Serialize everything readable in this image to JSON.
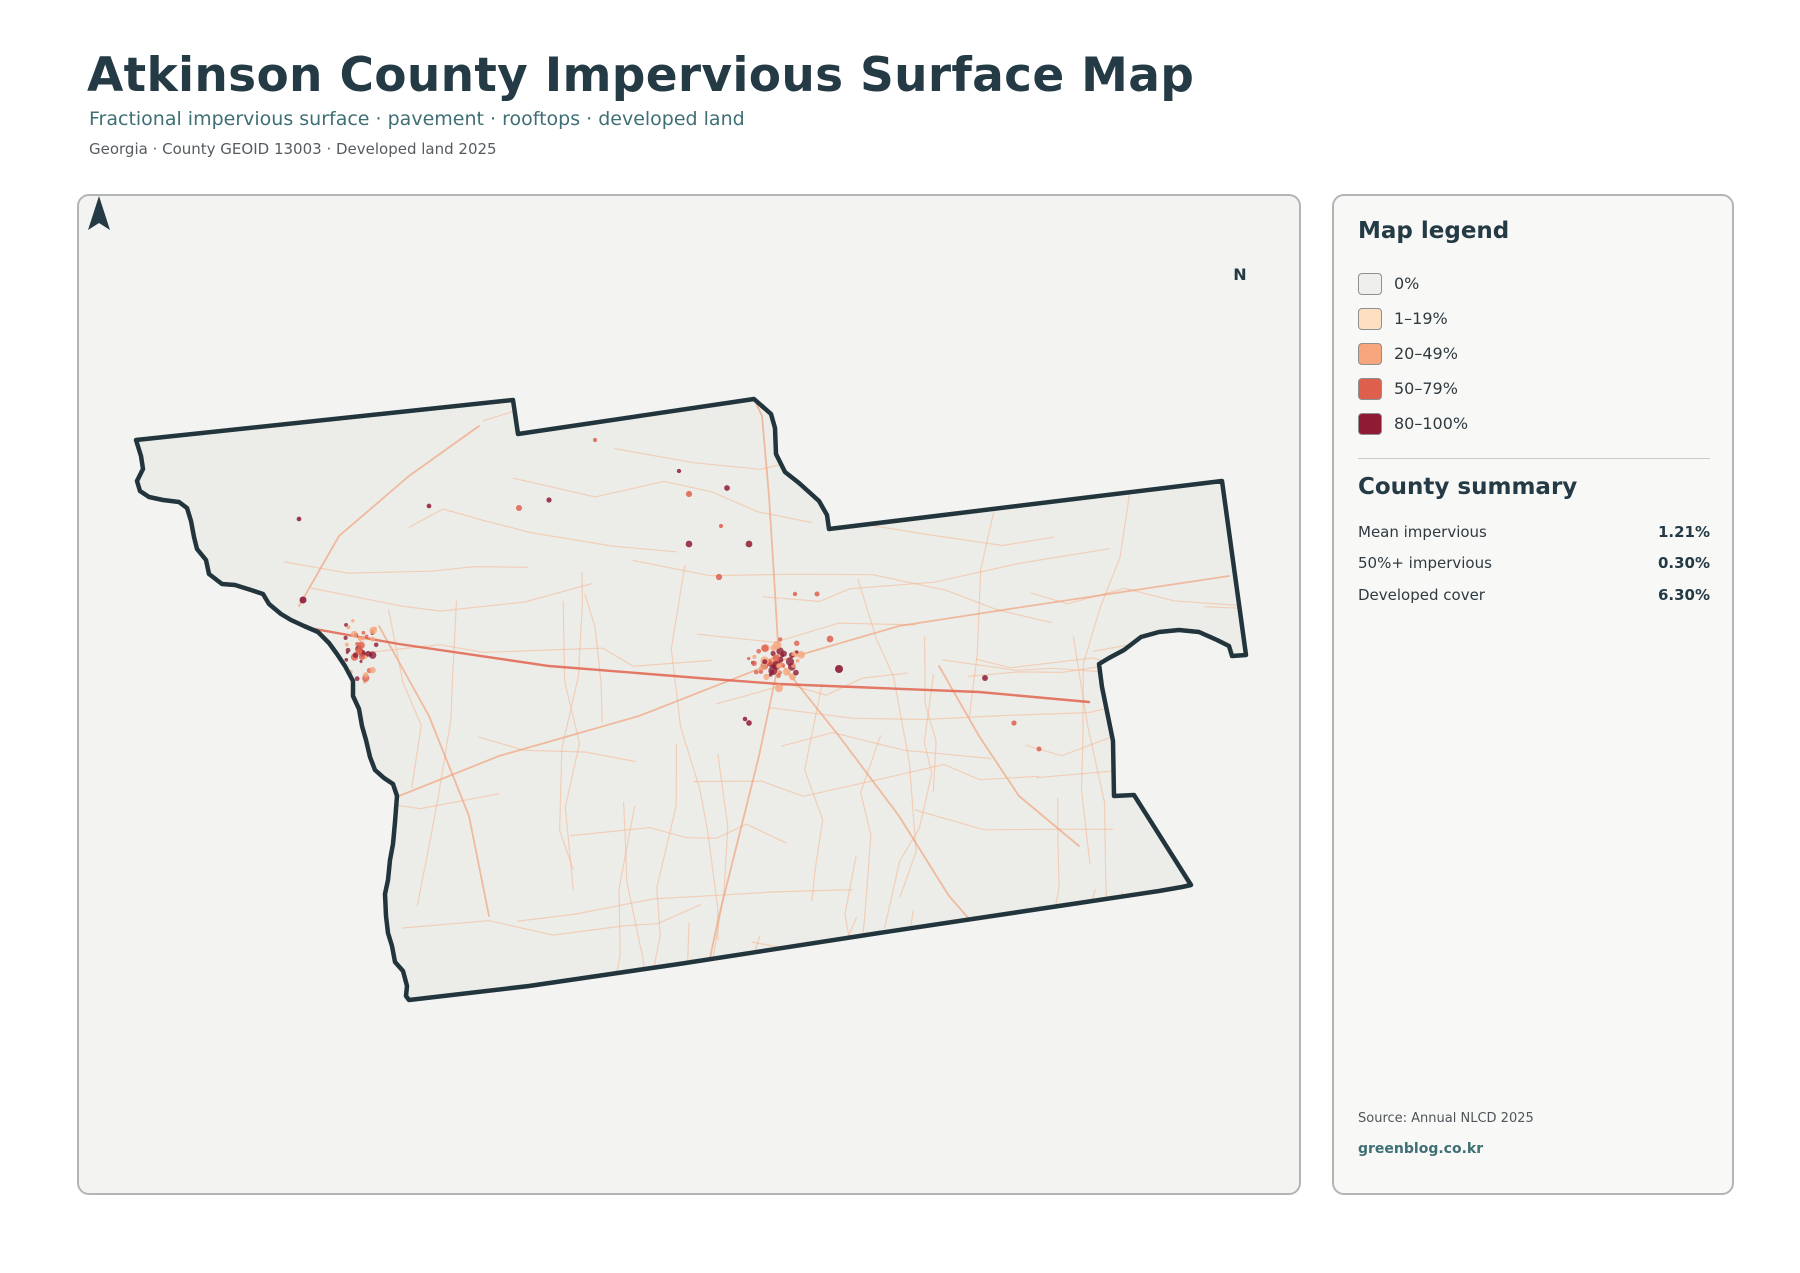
{
  "header": {
    "title": "Atkinson County Impervious Surface Map",
    "subtitle": "Fractional impervious surface · pavement · rooftops · developed land",
    "meta": "Georgia · County GEOID 13003 · Developed land 2025"
  },
  "map": {
    "north_label": "N",
    "outline_color": "#22353d",
    "land_color": "#ecede9",
    "road_color": "#f5b58e",
    "highway_color": "#e1634d"
  },
  "legend": {
    "title": "Map legend",
    "items": [
      {
        "label": "0%",
        "color": "#efefed"
      },
      {
        "label": "1–19%",
        "color": "#fde0c1"
      },
      {
        "label": "20–49%",
        "color": "#f6a57c"
      },
      {
        "label": "50–79%",
        "color": "#df5f4d"
      },
      {
        "label": "80–100%",
        "color": "#8f1a33"
      }
    ]
  },
  "summary": {
    "title": "County summary",
    "rows": [
      {
        "label": "Mean impervious",
        "value": "1.21%"
      },
      {
        "label": "50%+ impervious",
        "value": "0.30%"
      },
      {
        "label": "Developed cover",
        "value": "6.30%"
      }
    ]
  },
  "footer": {
    "source": "Source: Annual NLCD 2025",
    "site": "greenblog.co.kr"
  }
}
